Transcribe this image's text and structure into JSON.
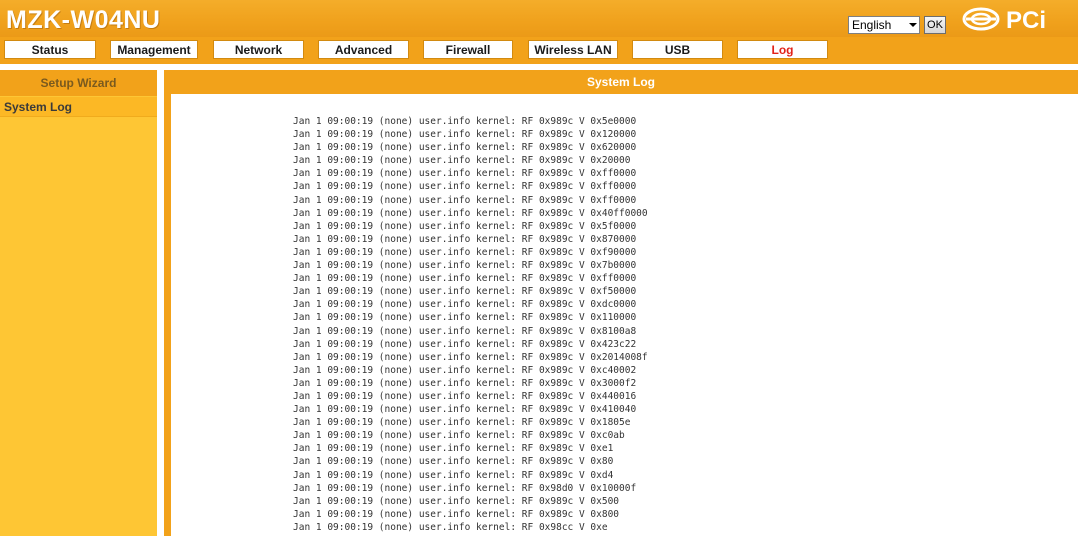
{
  "header": {
    "brand": "MZK-W04NU",
    "language": {
      "selected": "English"
    },
    "ok_label": "OK",
    "logo_text": "PCi"
  },
  "nav": [
    {
      "label": "Status"
    },
    {
      "label": "Management"
    },
    {
      "label": "Network"
    },
    {
      "label": "Advanced"
    },
    {
      "label": "Firewall"
    },
    {
      "label": "Wireless LAN"
    },
    {
      "label": "USB"
    },
    {
      "label": "Log",
      "active": true
    }
  ],
  "sidebar": {
    "header": "Setup Wizard",
    "items": [
      {
        "label": "System Log"
      }
    ]
  },
  "main": {
    "title": "System Log",
    "log_lines": [
      "Jan 1 09:00:19 (none) user.info kernel: RF 0x989c V 0x5e0000",
      "Jan 1 09:00:19 (none) user.info kernel: RF 0x989c V 0x120000",
      "Jan 1 09:00:19 (none) user.info kernel: RF 0x989c V 0x620000",
      "Jan 1 09:00:19 (none) user.info kernel: RF 0x989c V 0x20000",
      "Jan 1 09:00:19 (none) user.info kernel: RF 0x989c V 0xff0000",
      "Jan 1 09:00:19 (none) user.info kernel: RF 0x989c V 0xff0000",
      "Jan 1 09:00:19 (none) user.info kernel: RF 0x989c V 0xff0000",
      "Jan 1 09:00:19 (none) user.info kernel: RF 0x989c V 0x40ff0000",
      "Jan 1 09:00:19 (none) user.info kernel: RF 0x989c V 0x5f0000",
      "Jan 1 09:00:19 (none) user.info kernel: RF 0x989c V 0x870000",
      "Jan 1 09:00:19 (none) user.info kernel: RF 0x989c V 0xf90000",
      "Jan 1 09:00:19 (none) user.info kernel: RF 0x989c V 0x7b0000",
      "Jan 1 09:00:19 (none) user.info kernel: RF 0x989c V 0xff0000",
      "Jan 1 09:00:19 (none) user.info kernel: RF 0x989c V 0xf50000",
      "Jan 1 09:00:19 (none) user.info kernel: RF 0x989c V 0xdc0000",
      "Jan 1 09:00:19 (none) user.info kernel: RF 0x989c V 0x110000",
      "Jan 1 09:00:19 (none) user.info kernel: RF 0x989c V 0x8100a8",
      "Jan 1 09:00:19 (none) user.info kernel: RF 0x989c V 0x423c22",
      "Jan 1 09:00:19 (none) user.info kernel: RF 0x989c V 0x2014008f",
      "Jan 1 09:00:19 (none) user.info kernel: RF 0x989c V 0xc40002",
      "Jan 1 09:00:19 (none) user.info kernel: RF 0x989c V 0x3000f2",
      "Jan 1 09:00:19 (none) user.info kernel: RF 0x989c V 0x440016",
      "Jan 1 09:00:19 (none) user.info kernel: RF 0x989c V 0x410040",
      "Jan 1 09:00:19 (none) user.info kernel: RF 0x989c V 0x1805e",
      "Jan 1 09:00:19 (none) user.info kernel: RF 0x989c V 0xc0ab",
      "Jan 1 09:00:19 (none) user.info kernel: RF 0x989c V 0xe1",
      "Jan 1 09:00:19 (none) user.info kernel: RF 0x989c V 0x80",
      "Jan 1 09:00:19 (none) user.info kernel: RF 0x989c V 0xd4",
      "Jan 1 09:00:19 (none) user.info kernel: RF 0x98d0 V 0x10000f",
      "Jan 1 09:00:19 (none) user.info kernel: RF 0x989c V 0x500",
      "Jan 1 09:00:19 (none) user.info kernel: RF 0x989c V 0x800",
      "Jan 1 09:00:19 (none) user.info kernel: RF 0x98cc V 0xe"
    ]
  },
  "colors": {
    "header_orange": "#f2a21a",
    "sidebar_yellow": "#fec634",
    "active_nav": "#e2231a"
  },
  "icons": {
    "logo": "pci-logo-icon",
    "dropdown": "chevron-down-icon"
  }
}
